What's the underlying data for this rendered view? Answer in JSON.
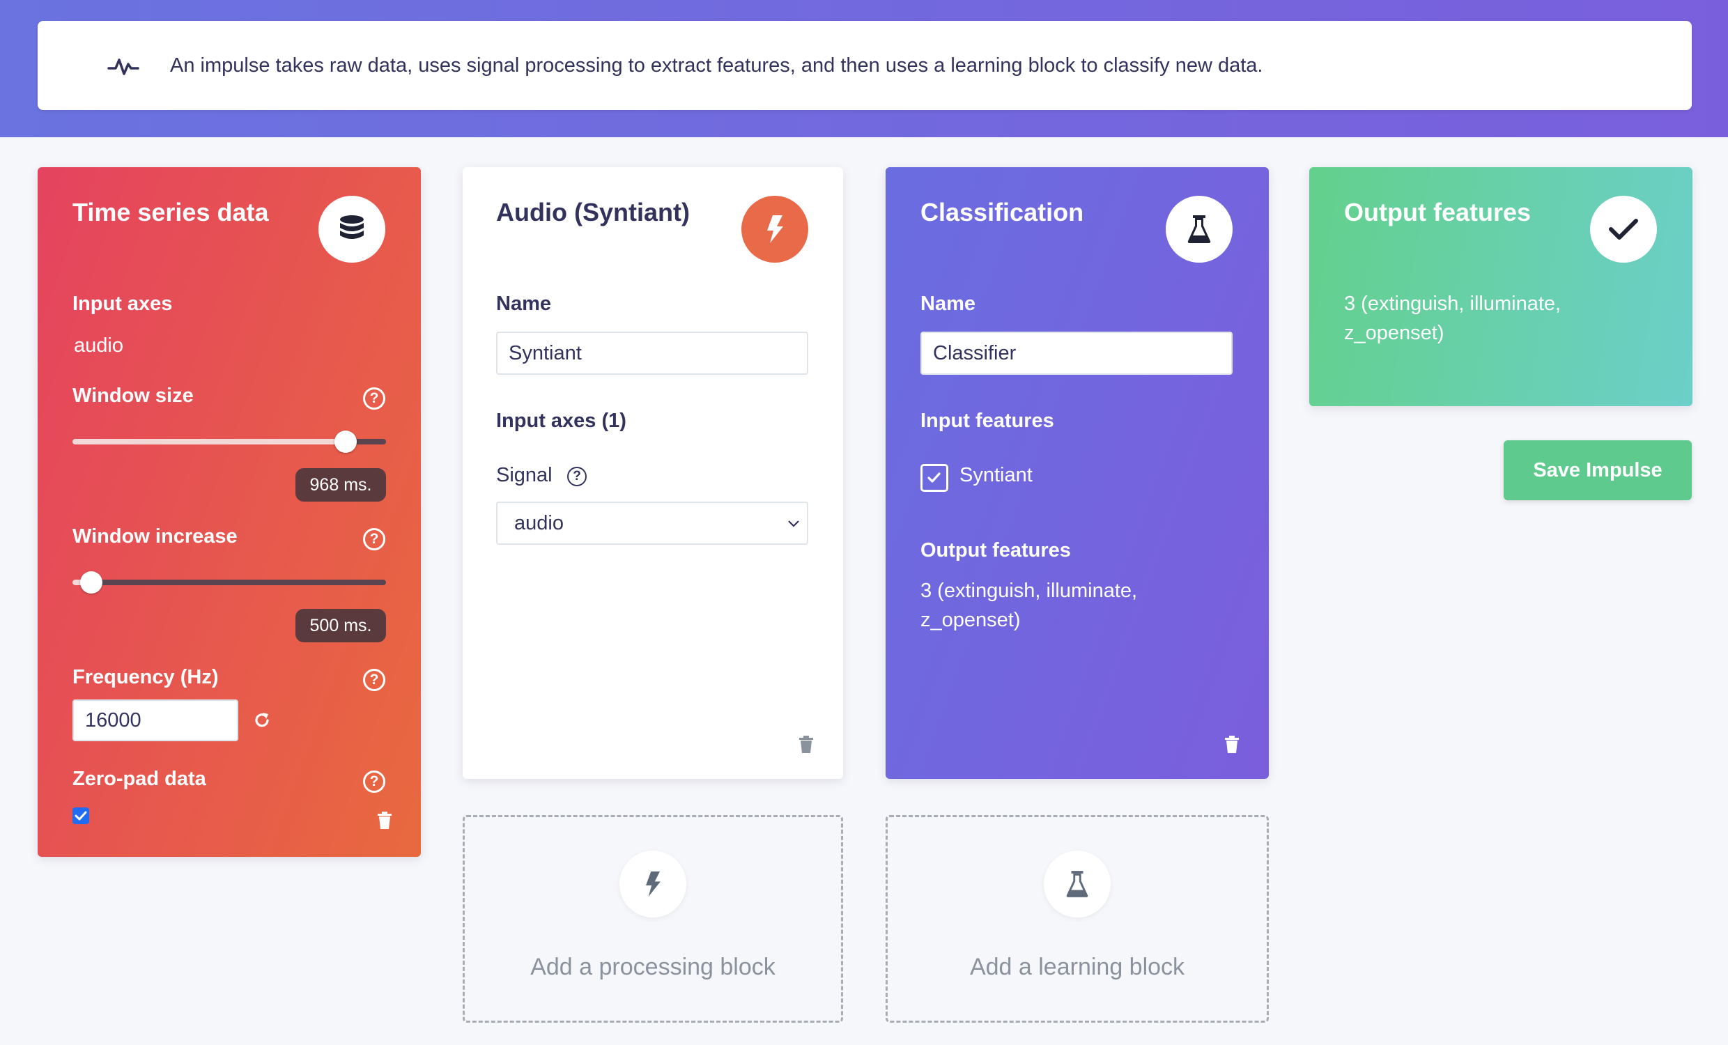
{
  "info": {
    "text": "An impulse takes raw data, uses signal processing to extract features, and then uses a learning block to classify new data."
  },
  "time_series": {
    "title": "Time series data",
    "input_axes_label": "Input axes",
    "input_axes_value": "audio",
    "window_size_label": "Window size",
    "window_size_value": "968 ms.",
    "window_size_fraction": 0.87,
    "window_increase_label": "Window increase",
    "window_increase_value": "500 ms.",
    "window_increase_fraction": 0.06,
    "frequency_label": "Frequency (Hz)",
    "frequency_value": "16000",
    "zero_pad_label": "Zero-pad data",
    "zero_pad_checked": true
  },
  "audio_block": {
    "title": "Audio (Syntiant)",
    "name_label": "Name",
    "name_value": "Syntiant",
    "input_axes_label": "Input axes (1)",
    "signal_label": "Signal",
    "signal_value": "audio"
  },
  "classification": {
    "title": "Classification",
    "name_label": "Name",
    "name_value": "Classifier",
    "input_features_label": "Input features",
    "input_feature_item": "Syntiant",
    "output_features_label": "Output features",
    "output_features_line1": "3 (extinguish, illuminate,",
    "output_features_line2": "z_openset)"
  },
  "output": {
    "title": "Output features",
    "line1": "3 (extinguish, illuminate,",
    "line2": "z_openset)"
  },
  "save_label": "Save Impulse",
  "add_processing": "Add a processing block",
  "add_learning": "Add a learning block",
  "colors": {
    "time_series_start": "#e5435f",
    "time_series_end": "#e8693f",
    "classification": "#6f68df",
    "output": "#63d08c",
    "save": "#5fca8e",
    "audio_icon": "#e96a48"
  },
  "icons": {
    "info": "pulse-icon",
    "time_series": "database-icon",
    "audio": "bolt-icon",
    "classification": "flask-icon",
    "output": "check-icon"
  }
}
